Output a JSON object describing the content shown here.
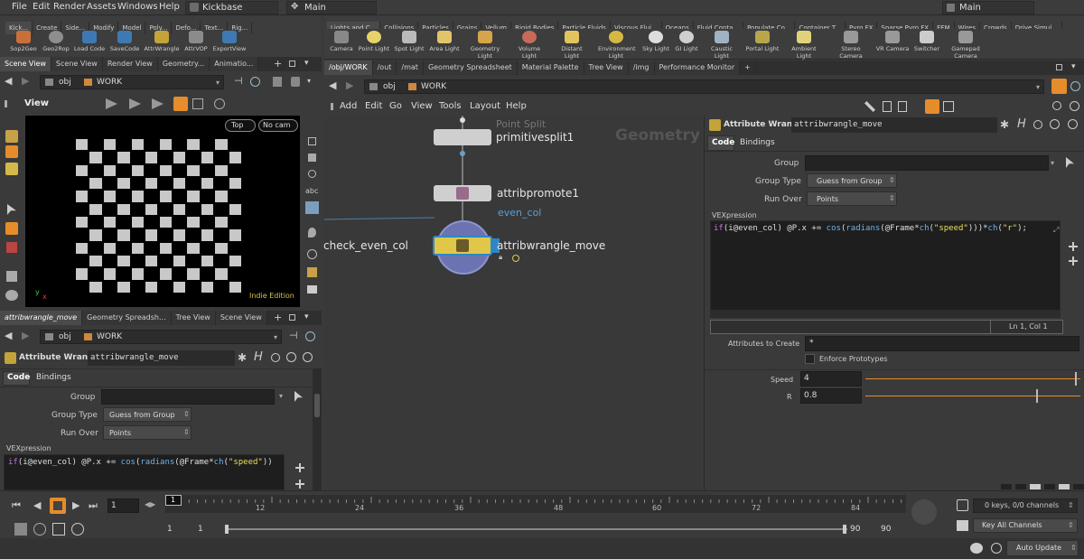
{
  "menubar": {
    "items": [
      "File",
      "Edit",
      "Render",
      "Assets",
      "Windows",
      "Help"
    ],
    "desktop": "Kickbase",
    "context_main": "Main",
    "right_main": "Main"
  },
  "shelf_left": {
    "tabs": [
      "Kick...",
      "Create",
      "Side...",
      "Modify",
      "Model",
      "Poly...",
      "Defo...",
      "Text...",
      "Rig..."
    ],
    "tools": [
      "Sop2Geo",
      "Geo2Rop",
      "Load Code",
      "SaveCode",
      "AttrWrangle",
      "AttrVOP",
      "ExportView"
    ]
  },
  "shelf_right": {
    "tabs": [
      "Lights and C...",
      "Collisions",
      "Particles",
      "Grains",
      "Vellum",
      "Rigid Bodies",
      "Particle Fluids",
      "Viscous Flui...",
      "Oceans",
      "Fluid Conta...",
      "Populate Co...",
      "Container T...",
      "Pyro FX",
      "Sparse Pyro FX",
      "FEM",
      "Wires",
      "Crowds",
      "Drive Simul..."
    ],
    "tools": [
      "Camera",
      "Point Light",
      "Spot Light",
      "Area Light",
      "Geometry Light",
      "Volume Light",
      "Distant Light",
      "Environment Light",
      "Sky Light",
      "GI Light",
      "Caustic Light",
      "Portal Light",
      "Ambient Light",
      "Stereo Camera",
      "VR Camera",
      "Switcher",
      "Gamepad Camera"
    ]
  },
  "viewer": {
    "tabs": [
      "Scene View",
      "Scene View",
      "Render View",
      "Geometry...",
      "Animatio..."
    ],
    "path_obj": "obj",
    "path_work": "WORK",
    "title": "View",
    "view_mode": "Top",
    "camera": "No cam",
    "watermark": "Indie Edition",
    "axis_y": "y",
    "axis_x": "x"
  },
  "lower_left": {
    "tabs": [
      "attribwrangle_move",
      "Geometry Spreadsh...",
      "Tree View",
      "Scene View"
    ],
    "path_obj": "obj",
    "path_work": "WORK",
    "node_type": "Attribute Wrangle",
    "node_name": "attribwrangle_move",
    "subtabs": [
      "Code",
      "Bindings"
    ],
    "group_label": "Group",
    "group_value": "",
    "group_type_label": "Group Type",
    "group_type_value": "Guess from Group",
    "run_over_label": "Run Over",
    "run_over_value": "Points",
    "vex_label": "VEXpression",
    "vex_code": "if(i@even_col) @P.x += cos(radians(@Frame*ch(\"speed\"))"
  },
  "network": {
    "tabs": [
      "/obj/WORK",
      "/out",
      "/mat",
      "Geometry Spreadsheet",
      "Material Palette",
      "Tree View",
      "/img",
      "Performance Monitor"
    ],
    "path_obj": "obj",
    "path_work": "WORK",
    "menus": [
      "Add",
      "Edit",
      "Go",
      "View",
      "Tools",
      "Layout",
      "Help"
    ],
    "context_label": "Geometry",
    "nodes": {
      "split_comment": "Point Split",
      "split_name": "primitivesplit1",
      "promote_name": "attribpromote1",
      "promote_comment": "even_col",
      "wrangle_name": "attribwrangle_move",
      "offscreen_name": "check_even_col"
    }
  },
  "params": {
    "node_type": "Attribute Wrangle",
    "node_name": "attribwrangle_move",
    "subtabs": [
      "Code",
      "Bindings"
    ],
    "group_label": "Group",
    "group_value": "",
    "group_type_label": "Group Type",
    "group_type_value": "Guess from Group",
    "run_over_label": "Run Over",
    "run_over_value": "Points",
    "vex_label": "VEXpression",
    "vex_code": "if(i@even_col) @P.x += cos(radians(@Frame*ch(\"speed\")))*ch(\"r\");",
    "cursor_pos": "Ln 1, Col 1",
    "attr_create_label": "Attributes to Create",
    "attr_create_value": "*",
    "enforce_label": "Enforce Prototypes",
    "speed_label": "Speed",
    "speed_value": "4",
    "speed_level": 0.98,
    "r_label": "R",
    "r_value": "0.8",
    "r_level": 0.8
  },
  "timeline": {
    "frame": "1",
    "ruler_start": "1",
    "ticks": [
      "12",
      "24",
      "36",
      "48",
      "60",
      "72",
      "84"
    ],
    "range_start": "1",
    "range_start2": "1",
    "range_end": "90",
    "range_end2": "90",
    "keys": "0 keys, 0/0 channels",
    "key_all": "Key All Channels",
    "auto_update": "Auto Update"
  },
  "colors": {
    "accent": "#e68c2a",
    "bg": "#3a3a3a",
    "dark": "#262626",
    "code_bg": "#1e1e1e",
    "node_blue": "#2f86c7"
  }
}
